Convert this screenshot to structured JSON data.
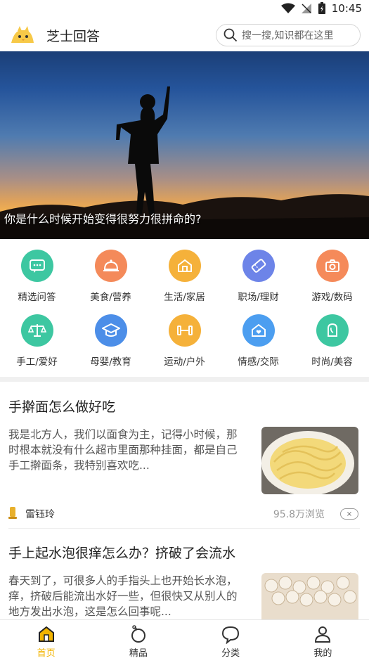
{
  "status": {
    "time": "10:45"
  },
  "header": {
    "app_title": "芝士回答",
    "search_placeholder": "搜一搜,知识都在这里"
  },
  "banner": {
    "caption": "你是什么时候开始变得很努力很拼命的?"
  },
  "categories": [
    {
      "label": "精选问答",
      "icon": "chat-icon",
      "color": "#3dc7a1"
    },
    {
      "label": "美食/营养",
      "icon": "food-cloche-icon",
      "color": "#f48a5a"
    },
    {
      "label": "生活/家居",
      "icon": "home-icon",
      "color": "#f5b13a"
    },
    {
      "label": "职场/理财",
      "icon": "ticket-icon",
      "color": "#6d84e8"
    },
    {
      "label": "游戏/数码",
      "icon": "camera-icon",
      "color": "#f58a5a"
    },
    {
      "label": "手工/爱好",
      "icon": "scale-icon",
      "color": "#3dc7a1"
    },
    {
      "label": "母婴/教育",
      "icon": "graduation-cap-icon",
      "color": "#4c8ee8"
    },
    {
      "label": "运动/户外",
      "icon": "dumbbell-icon",
      "color": "#f5b13a"
    },
    {
      "label": "情感/交际",
      "icon": "heart-home-icon",
      "color": "#4c9ef0"
    },
    {
      "label": "时尚/美容",
      "icon": "face-icon",
      "color": "#3dc7a1"
    }
  ],
  "articles": [
    {
      "title": "手擀面怎么做好吃",
      "excerpt": "我是北方人，我们以面食为主，记得小时候，那时根本就没有什么超市里面那种挂面，都是自己手工擀面条，我特别喜欢吃...",
      "author": "雷钰玲",
      "views": "95.8万浏览",
      "close": "×"
    },
    {
      "title": "手上起水泡很痒怎么办？挤破了会流水",
      "excerpt": "春天到了，可很多人的手指头上也开始长水泡，痒，挤破后能流出水好一些，但很快又从别人的地方发出水泡，这是怎么回事呢..."
    }
  ],
  "tabbar": [
    {
      "label": "首页",
      "icon": "home-tab-icon",
      "active": true
    },
    {
      "label": "精品",
      "icon": "premium-icon",
      "active": false
    },
    {
      "label": "分类",
      "icon": "category-bubble-icon",
      "active": false
    },
    {
      "label": "我的",
      "icon": "profile-icon",
      "active": false
    }
  ],
  "colors": {
    "accent": "#f2b400"
  }
}
